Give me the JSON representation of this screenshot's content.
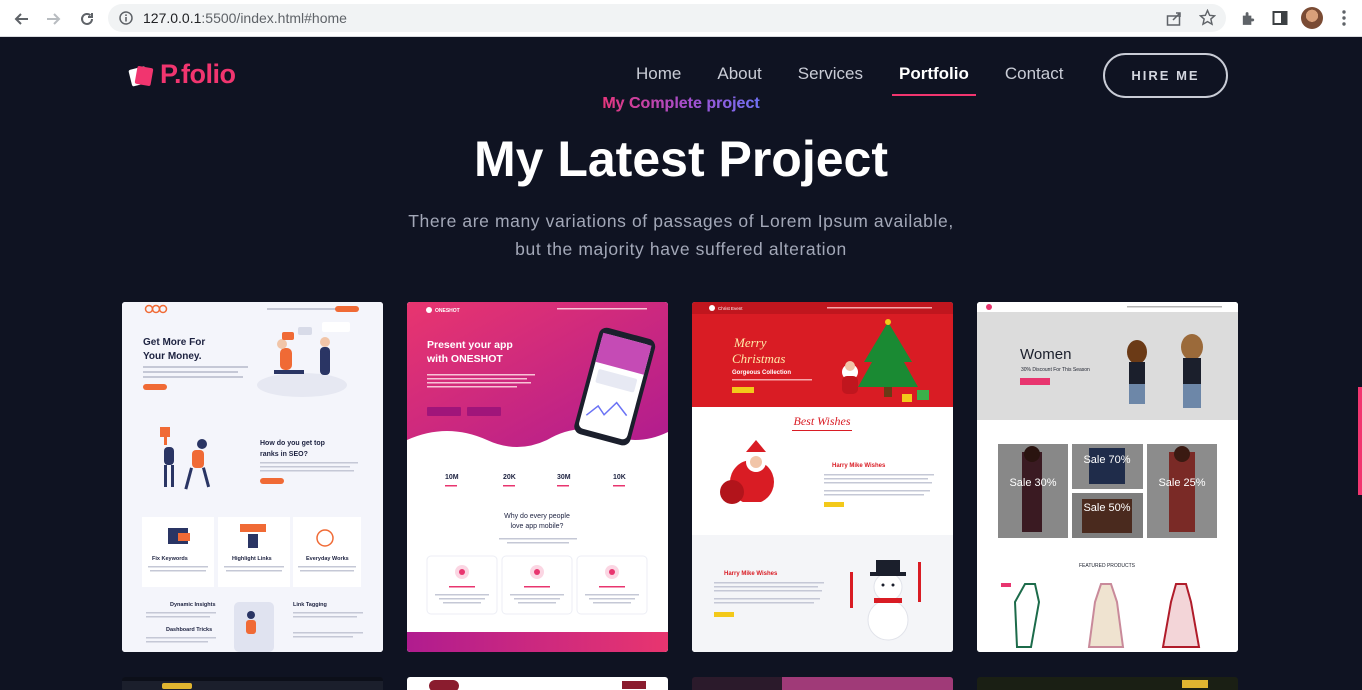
{
  "browser": {
    "url_host": "127.0.0.1",
    "url_rest": ":5500/index.html#home"
  },
  "header": {
    "logo_text": "P.folio",
    "nav": [
      {
        "label": "Home"
      },
      {
        "label": "About"
      },
      {
        "label": "Services"
      },
      {
        "label": "Portfolio",
        "active": true
      },
      {
        "label": "Contact"
      }
    ],
    "hire_label": "HIRE ME"
  },
  "section": {
    "subtitle": "My Complete project",
    "title": "My Latest Project",
    "description_line1": "There are many variations of passages of Lorem Ipsum available,",
    "description_line2": "but the majority have suffered alteration"
  },
  "projects": [
    {
      "heading": "Get More For Your Money.",
      "sub": "How do you get top ranks in SEO?",
      "features": [
        "Fix Keywords",
        "Highlight Links",
        "Everyday Works"
      ],
      "bottom": [
        "Dynamic Insights",
        "Link Tagging",
        "Dashboard Tricks"
      ]
    },
    {
      "heading": "Present your app with ONESHOT",
      "stats": [
        "10M",
        "20K",
        "30M",
        "10K"
      ],
      "question": "Why do every people love app mobile?"
    },
    {
      "brand": "Christ Event",
      "heading": "Merry Christmas",
      "sub": "Gorgeous Collection",
      "wishes": "Best Wishes",
      "card_title": "Harry Mike Wishes"
    },
    {
      "heading": "Women",
      "sub": "30% Discount For This Season",
      "sales": [
        "Sale 30%",
        "Sale 70%",
        "Sale 50%",
        "Sale 25%"
      ],
      "featured": "FEATURED PRODUCTS"
    }
  ],
  "colors": {
    "background": "#0f1322",
    "accent": "#f1356f",
    "gradient_start": "#e8357a",
    "gradient_end": "#6a72f5"
  }
}
